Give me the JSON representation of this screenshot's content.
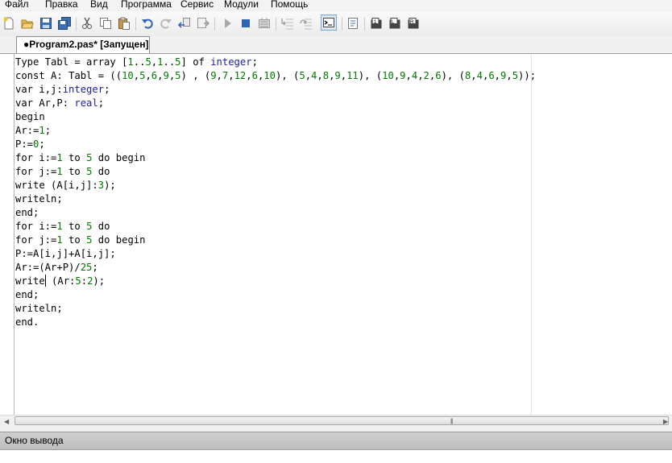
{
  "menu": [
    "Файл",
    "Правка",
    "Вид",
    "Программа",
    "Сервис",
    "Модули",
    "Помощь"
  ],
  "toolbar_icons": [
    "new-file-icon",
    "open-file-icon",
    "save-icon",
    "save-all-icon",
    "cut-icon",
    "copy-icon",
    "paste-icon",
    "undo-icon",
    "redo-icon",
    "run-icon",
    "stop-icon",
    "compile-icon",
    "step-icon",
    "step-over-icon",
    "output-window-icon",
    "debug-icon",
    "module-1-icon",
    "module-2-icon",
    "module-3-icon"
  ],
  "tab": {
    "title": "●Program2.pas* [Запущен]"
  },
  "code": [
    "Type Tabl = array [1..5,1..5] of integer;",
    "const A: Tabl = ((10,5,6,9,5) , (9,7,12,6,10), (5,4,8,9,11), (10,9,4,2,6), (8,4,6,9,5));",
    "var i,j:integer;",
    "var Ar,P: real;",
    "begin",
    "Ar:=1;",
    "P:=0;",
    "for i:=1 to 5 do begin",
    "for j:=1 to 5 do",
    "write (A[i,j]:3);",
    "writeln;",
    "end;",
    "for i:=1 to 5 do",
    "for j:=1 to 5 do begin",
    "P:=A[i,j]+A[i,j];",
    "Ar:=(Ar+P)/25;",
    "write (Ar:5:2);",
    "end;",
    "writeln;",
    "end."
  ],
  "output_panel": {
    "title": "Окно вывода"
  },
  "colors": {
    "number": "#007a00",
    "type": "#1c1ca0",
    "active_tool": "#dbe8f6"
  }
}
